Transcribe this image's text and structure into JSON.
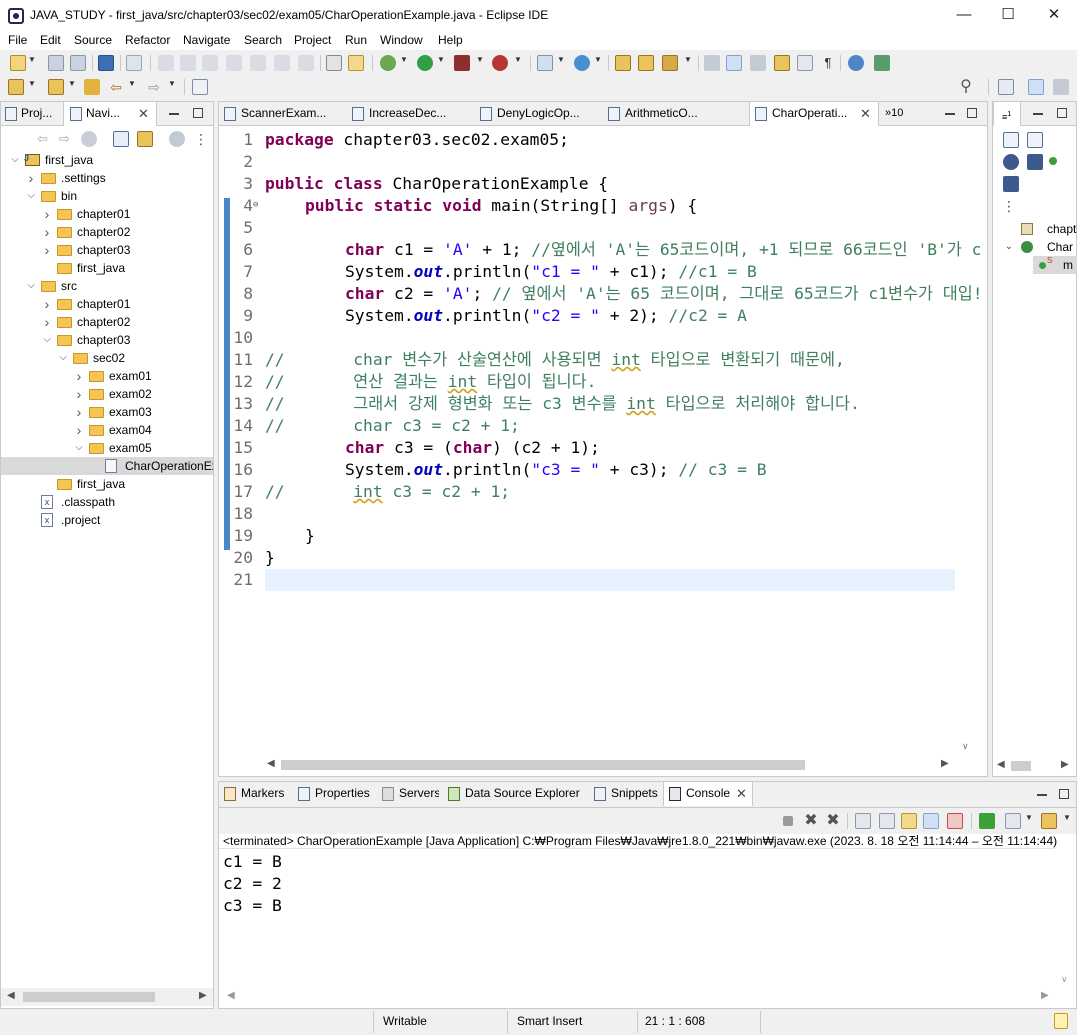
{
  "window": {
    "title": "JAVA_STUDY - first_java/src/chapter03/sec02/exam05/CharOperationExample.java - Eclipse IDE"
  },
  "menu": [
    "File",
    "Edit",
    "Source",
    "Refactor",
    "Navigate",
    "Search",
    "Project",
    "Run",
    "Window",
    "Help"
  ],
  "left_pane": {
    "tabs": [
      "Proj...",
      "Navi..."
    ],
    "tree": [
      {
        "label": "first_java",
        "depth": 0,
        "type": "project",
        "expanded": true
      },
      {
        "label": ".settings",
        "depth": 1,
        "type": "folder",
        "expanded": false
      },
      {
        "label": "bin",
        "depth": 1,
        "type": "folder",
        "expanded": true
      },
      {
        "label": "chapter01",
        "depth": 2,
        "type": "folder",
        "expanded": false
      },
      {
        "label": "chapter02",
        "depth": 2,
        "type": "folder",
        "expanded": false
      },
      {
        "label": "chapter03",
        "depth": 2,
        "type": "folder",
        "expanded": false
      },
      {
        "label": "first_java",
        "depth": 2,
        "type": "folder",
        "leaf": true
      },
      {
        "label": "src",
        "depth": 1,
        "type": "folder",
        "expanded": true
      },
      {
        "label": "chapter01",
        "depth": 2,
        "type": "folder",
        "expanded": false
      },
      {
        "label": "chapter02",
        "depth": 2,
        "type": "folder",
        "expanded": false
      },
      {
        "label": "chapter03",
        "depth": 2,
        "type": "folder",
        "expanded": true
      },
      {
        "label": "sec02",
        "depth": 3,
        "type": "folder",
        "expanded": true
      },
      {
        "label": "exam01",
        "depth": 4,
        "type": "folder",
        "expanded": false
      },
      {
        "label": "exam02",
        "depth": 4,
        "type": "folder",
        "expanded": false
      },
      {
        "label": "exam03",
        "depth": 4,
        "type": "folder",
        "expanded": false
      },
      {
        "label": "exam04",
        "depth": 4,
        "type": "folder",
        "expanded": false
      },
      {
        "label": "exam05",
        "depth": 4,
        "type": "folder",
        "expanded": true
      },
      {
        "label": "CharOperationEx",
        "depth": 5,
        "type": "file",
        "selected": true
      },
      {
        "label": "first_java",
        "depth": 2,
        "type": "folder",
        "leaf": true
      },
      {
        "label": ".classpath",
        "depth": 1,
        "type": "xml"
      },
      {
        "label": ".project",
        "depth": 1,
        "type": "xml"
      }
    ]
  },
  "editor": {
    "tabs": [
      "ScannerExam...",
      "IncreaseDec...",
      "DenyLogicOp...",
      "ArithmeticO...",
      "CharOperati..."
    ],
    "overflow_label": "»10",
    "line_numbers": [
      "1",
      "2",
      "3",
      "4",
      "5",
      "6",
      "7",
      "8",
      "9",
      "10",
      "11",
      "12",
      "13",
      "14",
      "15",
      "16",
      "17",
      "18",
      "19",
      "20",
      "21"
    ],
    "code": {
      "l1_kw": "package",
      "l1_rest": " chapter03.sec02.exam05;",
      "l3_kw1": "public",
      "l3_kw2": "class",
      "l3_rest": " CharOperationExample {",
      "l4_kw1": "public",
      "l4_kw2": "static",
      "l4_kw3": "void",
      "l4_rest": " main(String[] ",
      "l4_param": "args",
      "l4_end": ") {",
      "l6_kw": "char",
      "l6_a": " c1 = ",
      "l6_str": "'A'",
      "l6_b": " + 1; ",
      "l6_cmt": "//옆에서 'A'는 65코드이며, +1 되므로 66코드인 'B'가 c",
      "l7_a": "System.",
      "l7_fld": "out",
      "l7_b": ".println(",
      "l7_str": "\"c1 = \"",
      "l7_c": " + c1); ",
      "l7_cmt": "//c1 = B",
      "l8_kw": "char",
      "l8_a": " c2 = ",
      "l8_str": "'A'",
      "l8_b": "; ",
      "l8_cmt": "// 옆에서 'A'는 65 코드이며, 그대로 65코드가 c1변수가 대입!",
      "l9_a": "System.",
      "l9_fld": "out",
      "l9_b": ".println(",
      "l9_str": "\"c2 = \"",
      "l9_c": " + 2); ",
      "l9_cmt": "//c2 = A",
      "l11_a": "//       char 변수가 산술연산에 사용되면 ",
      "l11_w": "int",
      "l11_b": " 타입으로 변환되기 때문에,",
      "l12_a": "//       연산 결과는 ",
      "l12_w": "int",
      "l12_b": " 타입이 됩니다.",
      "l13_a": "//       그래서 강제 형변화 또는 c3 변수를 ",
      "l13_w": "int",
      "l13_b": " 타입으로 처리해야 합니다.",
      "l14": "//       char c3 = c2 + 1;",
      "l15_kw1": "char",
      "l15_a": " c3 = (",
      "l15_kw2": "char",
      "l15_b": ") (c2 + 1);",
      "l16_a": "System.",
      "l16_fld": "out",
      "l16_b": ".println(",
      "l16_str": "\"c3 = \"",
      "l16_c": " + c3); ",
      "l16_cmt": "// c3 = B",
      "l17_a": "//       ",
      "l17_w": "int",
      "l17_b": " c3 = c2 + 1;",
      "l19": "}",
      "l20": "}"
    }
  },
  "right_pane": {
    "items": [
      "chapt",
      "Char",
      "m"
    ]
  },
  "bottom": {
    "tabs": [
      "Markers",
      "Properties",
      "Servers",
      "Data Source Explorer",
      "Snippets",
      "Console"
    ],
    "terminated_line": "<terminated> CharOperationExample [Java Application] C:₩Program Files₩Java₩jre1.8.0_221₩bin₩javaw.exe  (2023. 8. 18 오전 11:14:44 – 오전 11:14:44)",
    "output": [
      "c1 = B",
      "c2 = 2",
      "c3 = B"
    ]
  },
  "status": {
    "writable": "Writable",
    "insert_mode": "Smart Insert",
    "position": "21 : 1 : 608"
  }
}
